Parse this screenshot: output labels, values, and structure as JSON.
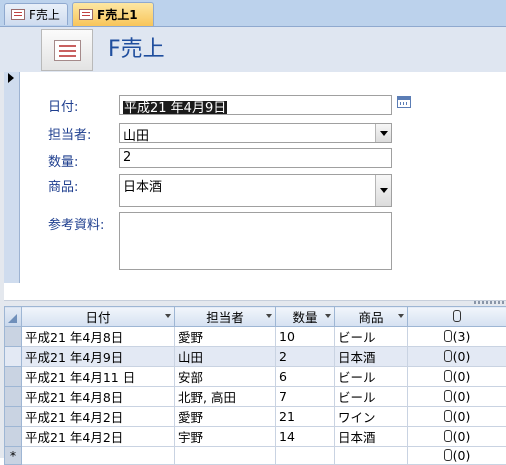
{
  "tabs": [
    {
      "label": "F売上",
      "icon": "form-icon",
      "active": false
    },
    {
      "label": "F売上1",
      "icon": "form-icon",
      "active": true
    }
  ],
  "header": {
    "title": "F売上",
    "icon": "form-icon"
  },
  "form": {
    "date_label": "日付:",
    "date_value": "平成21 年4月9日",
    "person_label": "担当者:",
    "person_value": "山田",
    "qty_label": "数量:",
    "qty_value": "2",
    "product_label": "商品:",
    "product_value": "日本酒",
    "ref_label": "参考資料:",
    "ref_value": ""
  },
  "datasheet": {
    "columns": [
      "日付",
      "担当者",
      "数量",
      "商品"
    ],
    "rows": [
      {
        "date": "平成21 年4月8日",
        "person": "愛野",
        "qty": "10",
        "product": "ビール",
        "att": "(3)"
      },
      {
        "date": "平成21 年4月9日",
        "person": "山田",
        "qty": "2",
        "product": "日本酒",
        "att": "(0)"
      },
      {
        "date": "平成21 年4月11 日",
        "person": "安部",
        "qty": "6",
        "product": "ビール",
        "att": "(0)"
      },
      {
        "date": "平成21 年4月8日",
        "person": "北野, 高田",
        "qty": "7",
        "product": "ビール",
        "att": "(0)"
      },
      {
        "date": "平成21 年4月2日",
        "person": "愛野",
        "qty": "21",
        "product": "ワイン",
        "att": "(0)"
      },
      {
        "date": "平成21 年4月2日",
        "person": "宇野",
        "qty": "14",
        "product": "日本酒",
        "att": "(0)"
      }
    ],
    "new_row_marker": "*",
    "new_row_att": "(0)"
  },
  "colors": {
    "title": "#1f4e9e",
    "label": "#1f3f8f",
    "active_tab": "#f8c55a"
  }
}
